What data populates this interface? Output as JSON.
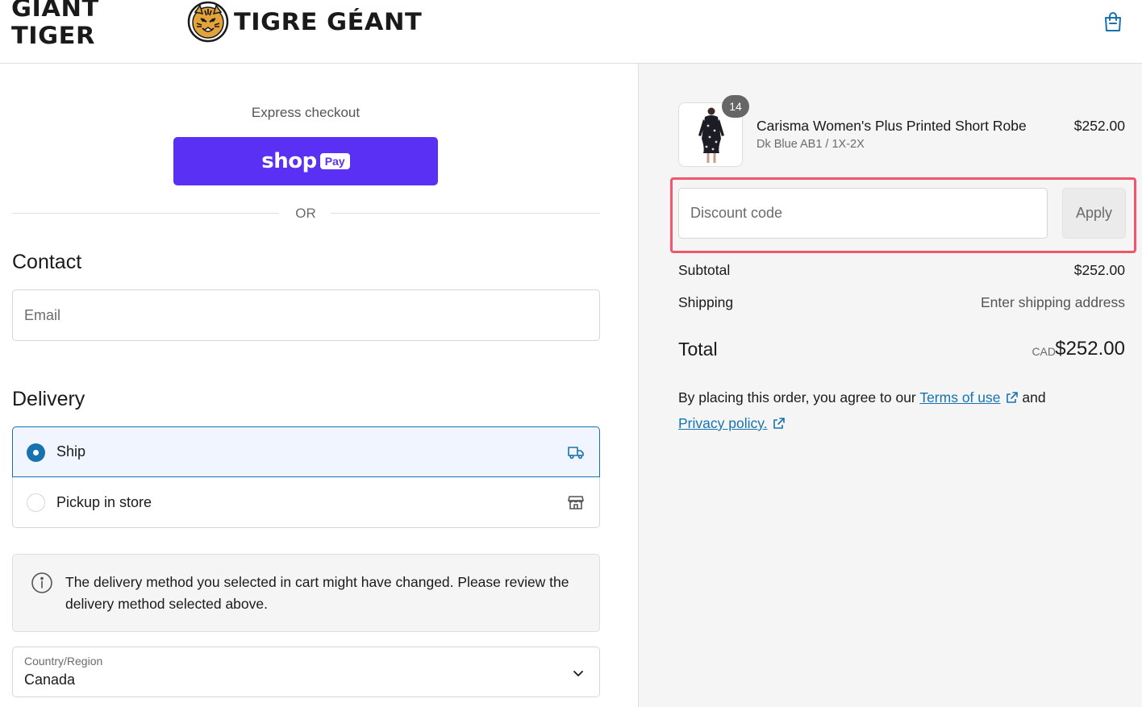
{
  "header": {
    "logo_en": "GIANT TIGER",
    "logo_fr": "TIGRE GÉANT",
    "logo_icon": "tiger-head-logo",
    "cart_icon": "shopping-bag-icon"
  },
  "express": {
    "title": "Express checkout",
    "shop_word": "shop",
    "pay_word": "Pay",
    "button_color": "#5a31f4",
    "or_label": "OR"
  },
  "contact": {
    "title": "Contact",
    "email_placeholder": "Email"
  },
  "delivery": {
    "title": "Delivery",
    "options": [
      {
        "label": "Ship",
        "selected": true,
        "icon": "truck-icon"
      },
      {
        "label": "Pickup in store",
        "selected": false,
        "icon": "store-icon"
      }
    ],
    "notice": "The delivery method you selected in cart might have changed. Please review the delivery method selected above.",
    "country_caption": "Country/Region",
    "country_value": "Canada"
  },
  "summary": {
    "product": {
      "quantity": "14",
      "name": "Carisma Women's Plus Printed Short Robe",
      "variant": "Dk Blue AB1 / 1X-2X",
      "price": "$252.00"
    },
    "discount_placeholder": "Discount code",
    "apply_label": "Apply",
    "subtotal_label": "Subtotal",
    "subtotal_value": "$252.00",
    "shipping_label": "Shipping",
    "shipping_value": "Enter shipping address",
    "total_label": "Total",
    "total_currency": "CAD",
    "total_value": "$252.00",
    "legal_prefix": "By placing this order, you agree to our",
    "terms_link": "Terms of use",
    "legal_and": "and",
    "privacy_link": "Privacy policy.",
    "highlight_color": "#f2566a",
    "link_color": "#1773b0"
  }
}
